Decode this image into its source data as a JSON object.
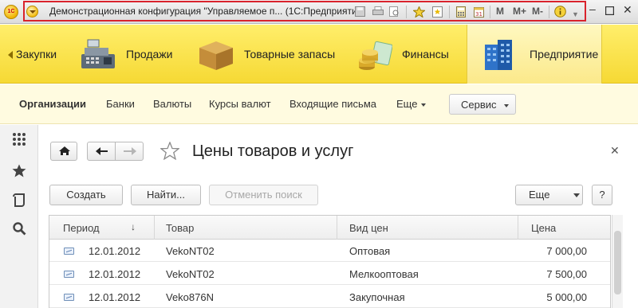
{
  "titlebar": {
    "app_logo": "1С",
    "title": "Демонстрационная конфигурация \"Управляемое п... (1С:Предприятие)",
    "memory_buttons": [
      "M",
      "M+",
      "M-"
    ],
    "icons": [
      "save-icon",
      "print-icon",
      "preview-icon",
      "favorites-star-icon",
      "bookmark-icon",
      "calculator-icon",
      "calendar-icon",
      "info-icon"
    ],
    "highlight_color": "#d9232d"
  },
  "sections": [
    {
      "label": "Закупки",
      "icon": "purchases-icon"
    },
    {
      "label": "Продажи",
      "icon": "cash-register-icon"
    },
    {
      "label": "Товарные запасы",
      "icon": "box-icon"
    },
    {
      "label": "Финансы",
      "icon": "coins-icon"
    },
    {
      "label": "Предприятие",
      "icon": "enterprise-building-icon",
      "active": true
    }
  ],
  "functions": [
    {
      "label": "Организации",
      "bold": true
    },
    {
      "label": "Банки"
    },
    {
      "label": "Валюты"
    },
    {
      "label": "Курсы валют"
    },
    {
      "label": "Входящие письма"
    },
    {
      "label": "Еще"
    }
  ],
  "service_button": "Сервис",
  "leftpanel": {
    "icons": [
      "apps-grid-icon",
      "favorites-star-icon",
      "history-icon",
      "search-icon"
    ]
  },
  "form": {
    "title": "Цены товаров и услуг",
    "buttons": {
      "create": "Создать",
      "find": "Найти...",
      "cancel_search": "Отменить поиск",
      "more": "Еще",
      "help": "?"
    }
  },
  "table": {
    "columns": [
      "Период",
      "Товар",
      "Вид цен",
      "Цена"
    ],
    "sort_indicator": "↓",
    "rows": [
      {
        "period": "12.01.2012",
        "product": "VekoNT02",
        "price_type": "Оптовая",
        "price": "7 000,00"
      },
      {
        "period": "12.01.2012",
        "product": "VekoNT02",
        "price_type": "Мелкооптовая",
        "price": "7 500,00"
      },
      {
        "period": "12.01.2012",
        "product": "Veko876N",
        "price_type": "Закупочная",
        "price": "5 000,00"
      }
    ]
  },
  "colors": {
    "sections_bg": "#f6d934",
    "funcbar_bg": "#fffbe0",
    "accent_red": "#d9232d"
  }
}
